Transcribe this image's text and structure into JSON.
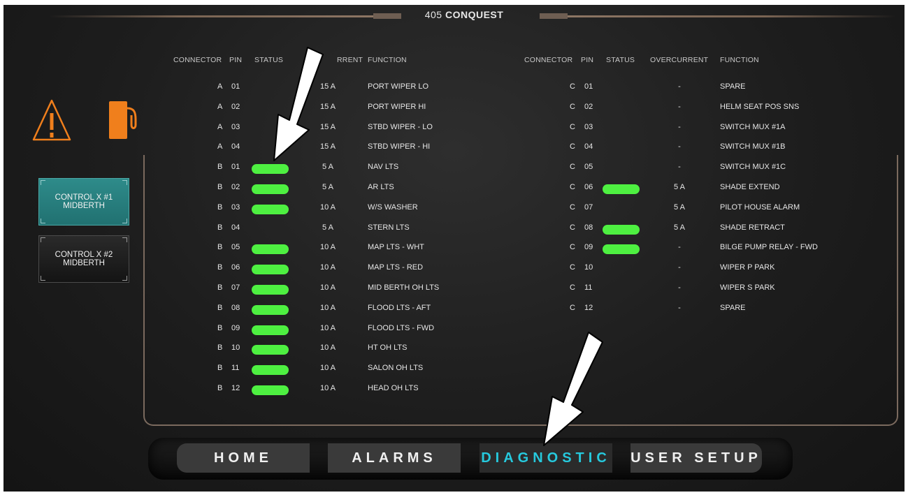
{
  "header": {
    "title_num": "405",
    "title_name": "CONQUEST"
  },
  "controls": [
    {
      "label": "CONTROL X #1\nMIDBERTH",
      "active": true
    },
    {
      "label": "CONTROL X #2\nMIDBERTH",
      "active": false
    }
  ],
  "table_headers": {
    "connector": "CONNECTOR",
    "pin": "PIN",
    "status": "STATUS",
    "overcurrent_left_visible": "RRENT",
    "overcurrent": "OVERCURRENT",
    "function": "FUNCTION"
  },
  "left_rows": [
    {
      "connector": "A",
      "pin": "01",
      "status": false,
      "overcurrent": "15 A",
      "function": "PORT WIPER LO"
    },
    {
      "connector": "A",
      "pin": "02",
      "status": false,
      "overcurrent": "15 A",
      "function": "PORT WIPER HI"
    },
    {
      "connector": "A",
      "pin": "03",
      "status": false,
      "overcurrent": "15 A",
      "function": "STBD WIPER - LO"
    },
    {
      "connector": "A",
      "pin": "04",
      "status": false,
      "overcurrent": "15 A",
      "function": "STBD WIPER - HI"
    },
    {
      "connector": "B",
      "pin": "01",
      "status": true,
      "overcurrent": "5 A",
      "function": "NAV LTS"
    },
    {
      "connector": "B",
      "pin": "02",
      "status": true,
      "overcurrent": "5 A",
      "function": "AR LTS"
    },
    {
      "connector": "B",
      "pin": "03",
      "status": true,
      "overcurrent": "10 A",
      "function": "W/S WASHER"
    },
    {
      "connector": "B",
      "pin": "04",
      "status": false,
      "overcurrent": "5 A",
      "function": "STERN LTS"
    },
    {
      "connector": "B",
      "pin": "05",
      "status": true,
      "overcurrent": "10 A",
      "function": "MAP LTS - WHT"
    },
    {
      "connector": "B",
      "pin": "06",
      "status": true,
      "overcurrent": "10 A",
      "function": "MAP LTS - RED"
    },
    {
      "connector": "B",
      "pin": "07",
      "status": true,
      "overcurrent": "10 A",
      "function": "MID BERTH OH LTS"
    },
    {
      "connector": "B",
      "pin": "08",
      "status": true,
      "overcurrent": "10 A",
      "function": "FLOOD LTS - AFT"
    },
    {
      "connector": "B",
      "pin": "09",
      "status": true,
      "overcurrent": "10 A",
      "function": "FLOOD LTS - FWD"
    },
    {
      "connector": "B",
      "pin": "10",
      "status": true,
      "overcurrent": "10 A",
      "function": "HT OH LTS"
    },
    {
      "connector": "B",
      "pin": "11",
      "status": true,
      "overcurrent": "10 A",
      "function": "SALON OH LTS"
    },
    {
      "connector": "B",
      "pin": "12",
      "status": true,
      "overcurrent": "10 A",
      "function": "HEAD OH LTS"
    }
  ],
  "right_rows": [
    {
      "connector": "C",
      "pin": "01",
      "status": false,
      "overcurrent": "-",
      "function": "SPARE"
    },
    {
      "connector": "C",
      "pin": "02",
      "status": false,
      "overcurrent": "-",
      "function": "HELM SEAT POS SNS"
    },
    {
      "connector": "C",
      "pin": "03",
      "status": false,
      "overcurrent": "-",
      "function": "SWITCH MUX #1A"
    },
    {
      "connector": "C",
      "pin": "04",
      "status": false,
      "overcurrent": "-",
      "function": "SWITCH MUX #1B"
    },
    {
      "connector": "C",
      "pin": "05",
      "status": false,
      "overcurrent": "-",
      "function": "SWITCH MUX #1C"
    },
    {
      "connector": "C",
      "pin": "06",
      "status": true,
      "overcurrent": "5 A",
      "function": "SHADE EXTEND"
    },
    {
      "connector": "C",
      "pin": "07",
      "status": false,
      "overcurrent": "5 A",
      "function": "PILOT HOUSE ALARM"
    },
    {
      "connector": "C",
      "pin": "08",
      "status": true,
      "overcurrent": "5 A",
      "function": "SHADE RETRACT"
    },
    {
      "connector": "C",
      "pin": "09",
      "status": true,
      "overcurrent": "-",
      "function": "BILGE PUMP RELAY - FWD"
    },
    {
      "connector": "C",
      "pin": "10",
      "status": false,
      "overcurrent": "-",
      "function": "WIPER P PARK"
    },
    {
      "connector": "C",
      "pin": "11",
      "status": false,
      "overcurrent": "-",
      "function": "WIPER S PARK"
    },
    {
      "connector": "C",
      "pin": "12",
      "status": false,
      "overcurrent": "-",
      "function": "SPARE"
    }
  ],
  "nav": {
    "home": "HOME",
    "alarms": "ALARMS",
    "diagnostic": "DIAGNOSTIC",
    "user_setup": "USER SETUP",
    "active": "diagnostic"
  },
  "colors": {
    "status_on": "#4ef041",
    "accent_orange": "#f07f1c",
    "accent_teal": "#26c9dd",
    "control_active": "#2e8b8a"
  },
  "icons": {
    "warning": "warning-icon",
    "fuel": "fuel-pump-icon",
    "arrows": "callout-arrow-icon"
  }
}
